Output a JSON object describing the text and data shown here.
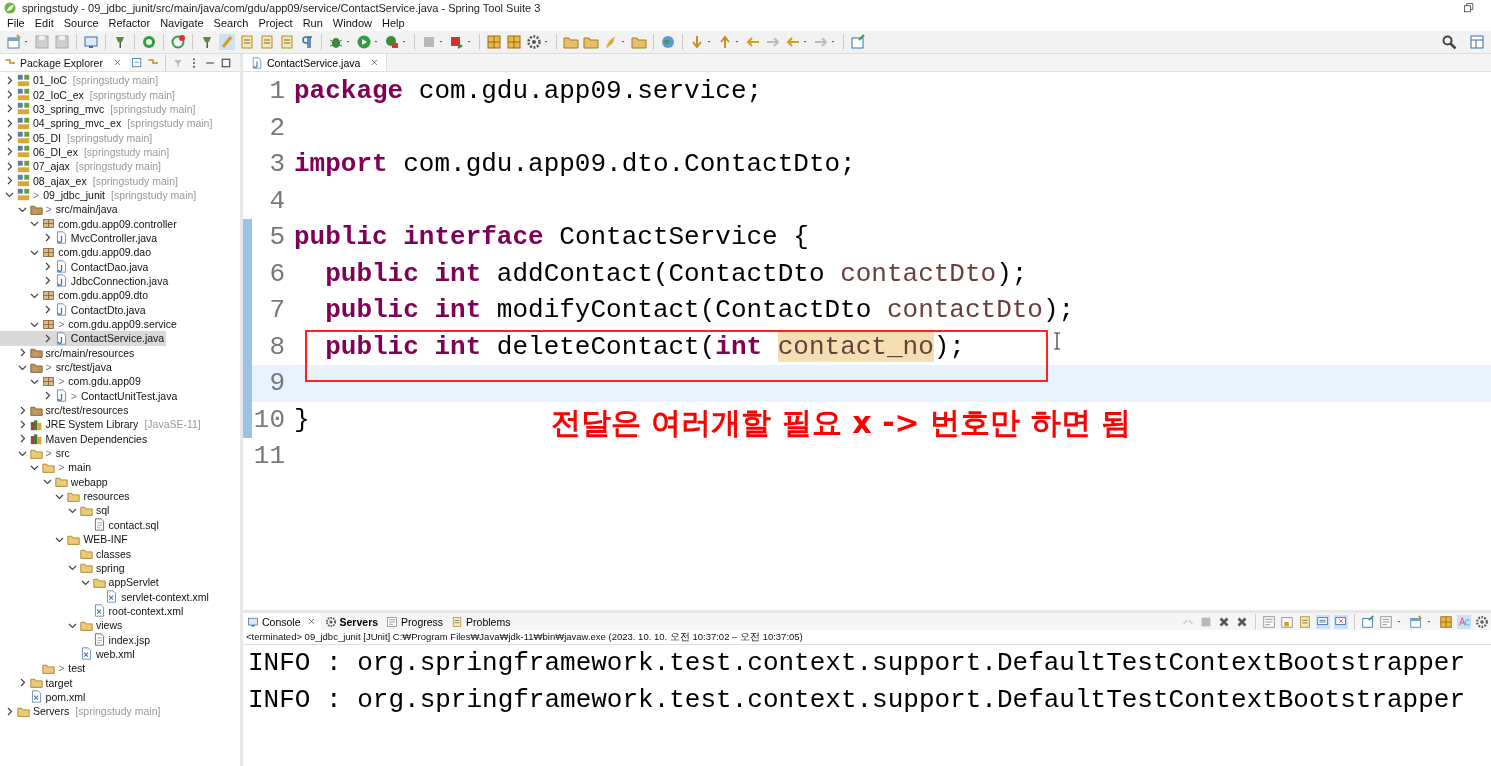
{
  "window": {
    "title": "springstudy - 09_jdbc_junit/src/main/java/com/gdu/app09/service/ContactService.java - Spring Tool Suite 3"
  },
  "menu": [
    "File",
    "Edit",
    "Source",
    "Refactor",
    "Navigate",
    "Search",
    "Project",
    "Run",
    "Window",
    "Help"
  ],
  "explorer": {
    "tab": {
      "label": "Package Explorer",
      "selected": true
    },
    "tree": [
      {
        "label": "01_IoC",
        "decoration": "[springstudy main]",
        "kind": "project",
        "expanded": false
      },
      {
        "label": "02_IoC_ex",
        "decoration": "[springstudy main]",
        "kind": "project",
        "expanded": false
      },
      {
        "label": "03_spring_mvc",
        "decoration": "[springstudy main]",
        "kind": "project",
        "expanded": false
      },
      {
        "label": "04_spring_mvc_ex",
        "decoration": "[springstudy main]",
        "kind": "project",
        "expanded": false
      },
      {
        "label": "05_DI",
        "decoration": "[springstudy main]",
        "kind": "project",
        "expanded": false
      },
      {
        "label": "06_DI_ex",
        "decoration": "[springstudy main]",
        "kind": "project",
        "expanded": false
      },
      {
        "label": "07_ajax",
        "decoration": "[springstudy main]",
        "kind": "project",
        "expanded": false
      },
      {
        "label": "08_ajax_ex",
        "decoration": "[springstudy main]",
        "kind": "project",
        "expanded": false
      },
      {
        "label": "09_jdbc_junit",
        "decoration": "[springstudy main]",
        "kind": "project",
        "marker": ">",
        "expanded": true,
        "children": [
          {
            "label": "src/main/java",
            "kind": "source",
            "marker": ">",
            "expanded": true,
            "children": [
              {
                "label": "com.gdu.app09.controller",
                "kind": "package",
                "expanded": true,
                "children": [
                  {
                    "label": "MvcController.java",
                    "kind": "java",
                    "expanded": false,
                    "selected": false
                  }
                ]
              },
              {
                "label": "com.gdu.app09.dao",
                "kind": "package",
                "expanded": true,
                "children": [
                  {
                    "label": "ContactDao.java",
                    "kind": "java",
                    "expanded": false,
                    "selected": false
                  },
                  {
                    "label": "JdbcConnection.java",
                    "kind": "java",
                    "expanded": false,
                    "selected": false
                  }
                ]
              },
              {
                "label": "com.gdu.app09.dto",
                "kind": "package",
                "expanded": true,
                "children": [
                  {
                    "label": "ContactDto.java",
                    "kind": "java",
                    "expanded": false,
                    "selected": false
                  }
                ]
              },
              {
                "label": "com.gdu.app09.service",
                "kind": "package",
                "marker": ">",
                "expanded": true,
                "children": [
                  {
                    "label": "ContactService.java",
                    "kind": "java",
                    "expanded": false,
                    "selected": true
                  }
                ]
              }
            ]
          },
          {
            "label": "src/main/resources",
            "kind": "source",
            "expanded": false
          },
          {
            "label": "src/test/java",
            "kind": "source",
            "marker": ">",
            "expanded": true,
            "children": [
              {
                "label": "com.gdu.app09",
                "kind": "package",
                "marker": ">",
                "expanded": true,
                "children": [
                  {
                    "label": "ContactUnitTest.java",
                    "kind": "java",
                    "marker": ">",
                    "expanded": false,
                    "selected": false
                  }
                ]
              }
            ]
          },
          {
            "label": "src/test/resources",
            "kind": "source",
            "expanded": false
          },
          {
            "label": "JRE System Library",
            "decoration": "[JavaSE-11]",
            "kind": "library",
            "expanded": false
          },
          {
            "label": "Maven Dependencies",
            "kind": "library",
            "expanded": false
          },
          {
            "label": "src",
            "kind": "folder",
            "marker": ">",
            "expanded": true,
            "children": [
              {
                "label": "main",
                "kind": "folder",
                "marker": ">",
                "expanded": true,
                "children": [
                  {
                    "label": "webapp",
                    "kind": "folder",
                    "expanded": true,
                    "children": [
                      {
                        "label": "resources",
                        "kind": "folder",
                        "expanded": true,
                        "children": [
                          {
                            "label": "sql",
                            "kind": "folder",
                            "expanded": true,
                            "children": [
                              {
                                "label": "contact.sql",
                                "kind": "file"
                              }
                            ]
                          }
                        ]
                      },
                      {
                        "label": "WEB-INF",
                        "kind": "folder",
                        "expanded": true,
                        "children": [
                          {
                            "label": "classes",
                            "kind": "folder"
                          },
                          {
                            "label": "spring",
                            "kind": "folder",
                            "expanded": true,
                            "children": [
                              {
                                "label": "appServlet",
                                "kind": "folder",
                                "expanded": true,
                                "children": [
                                  {
                                    "label": "servlet-context.xml",
                                    "kind": "xml"
                                  }
                                ]
                              },
                              {
                                "label": "root-context.xml",
                                "kind": "xml"
                              }
                            ]
                          },
                          {
                            "label": "views",
                            "kind": "folder",
                            "expanded": true,
                            "children": [
                              {
                                "label": "index.jsp",
                                "kind": "file"
                              }
                            ]
                          },
                          {
                            "label": "web.xml",
                            "kind": "xml"
                          }
                        ]
                      }
                    ]
                  }
                ]
              },
              {
                "label": "test",
                "kind": "folder",
                "marker": ">"
              }
            ]
          },
          {
            "label": "target",
            "kind": "folder",
            "expanded": false
          },
          {
            "label": "pom.xml",
            "kind": "xml"
          }
        ]
      },
      {
        "label": "Servers",
        "decoration": "[springstudy main]",
        "kind": "folder",
        "expanded": false
      }
    ]
  },
  "editor": {
    "tab": {
      "label": "ContactService.java",
      "selected": true
    },
    "lines": [
      {
        "number": "1",
        "changed": false,
        "current": false,
        "indented": false,
        "tokens": [
          {
            "text": "package",
            "kind": "keyword"
          },
          {
            "text": "com.gdu.app09.service;",
            "kind": "text"
          }
        ]
      },
      {
        "number": "2",
        "changed": false,
        "current": false
      },
      {
        "number": "3",
        "changed": false,
        "current": false,
        "indented": false,
        "tokens": [
          {
            "text": "import",
            "kind": "keyword"
          },
          {
            "text": "com.gdu.app09.dto.ContactDto;",
            "kind": "text"
          }
        ]
      },
      {
        "number": "4",
        "changed": false,
        "current": false
      },
      {
        "number": "5",
        "changed": true,
        "current": false,
        "indented": false,
        "tokens": [
          {
            "text": "public",
            "kind": "keyword"
          },
          {
            "text": "interface",
            "kind": "keyword"
          },
          {
            "text": "ContactService {",
            "kind": "text"
          }
        ]
      },
      {
        "number": "6",
        "changed": true,
        "current": false,
        "indented": true,
        "tokens": [
          {
            "text": "public",
            "kind": "keyword"
          },
          {
            "text": "int",
            "kind": "keyword"
          },
          {
            "text": "addContact(ContactDto",
            "kind": "text"
          },
          {
            "text": "contactDto",
            "kind": "param"
          },
          {
            "text": ");",
            "kind": "text",
            "attached": true
          }
        ]
      },
      {
        "number": "7",
        "changed": true,
        "current": false,
        "indented": true,
        "tokens": [
          {
            "text": "public",
            "kind": "keyword"
          },
          {
            "text": "int",
            "kind": "keyword"
          },
          {
            "text": "modifyContact(ContactDto",
            "kind": "text"
          },
          {
            "text": "contactDto",
            "kind": "param"
          },
          {
            "text": ");",
            "kind": "text",
            "attached": true
          }
        ]
      },
      {
        "number": "8",
        "changed": true,
        "current": false,
        "indented": true,
        "tokens": [
          {
            "text": "public",
            "kind": "keyword"
          },
          {
            "text": "int",
            "kind": "keyword"
          },
          {
            "text": "deleteContact(",
            "kind": "text"
          },
          {
            "text": "int",
            "kind": "keyword",
            "attached": true
          },
          {
            "text": "contact_no",
            "kind": "occurrence"
          },
          {
            "text": ");",
            "kind": "text",
            "attached": true
          }
        ]
      },
      {
        "number": "9",
        "changed": true,
        "current": true
      },
      {
        "number": "10",
        "changed": true,
        "current": false,
        "indented": false,
        "tokens": [
          {
            "text": "}",
            "kind": "text"
          }
        ]
      },
      {
        "number": "11",
        "changed": false,
        "current": false
      }
    ],
    "annotation": {
      "text": "전달은 여러개할 필요 x -> 번호만 하면 됨"
    }
  },
  "console": {
    "tabs": [
      {
        "label": "Console",
        "selected": true,
        "bold": false
      },
      {
        "label": "Servers",
        "selected": false,
        "bold": true
      },
      {
        "label": "Progress",
        "selected": false,
        "bold": false
      },
      {
        "label": "Problems",
        "selected": false,
        "bold": false
      }
    ],
    "status": "<terminated> 09_jdbc_junit [JUnit] C:₩Program Files₩Java₩jdk-11₩bin₩javaw.exe  (2023. 10. 10. 오전 10:37:02 – 오전 10:37:05)",
    "output": [
      "INFO : org.springframework.test.context.support.DefaultTestContextBootstrapper",
      "INFO : org.springframework.test.context.support.DefaultTestContextBootstrapper"
    ]
  }
}
